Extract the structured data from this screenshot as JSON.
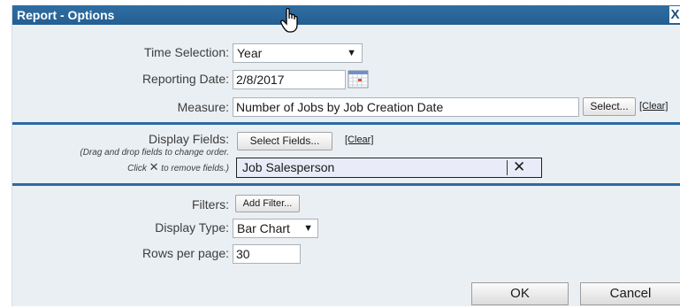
{
  "dialog": {
    "title": "Report - Options",
    "close_icon": "close-icon",
    "close_symbol": "X"
  },
  "time_selection": {
    "label": "Time Selection:",
    "value": "Year",
    "arrow": "▼"
  },
  "reporting_date": {
    "label": "Reporting Date:",
    "value": "2/8/2017",
    "icon": "calendar-icon"
  },
  "measure": {
    "label": "Measure:",
    "value": "Number of Jobs by Job Creation Date",
    "select_button": "Select...",
    "clear_link": "[Clear]"
  },
  "display_fields": {
    "label": "Display Fields:",
    "hint_line1": "(Drag and drop fields to change order.",
    "hint_line2_pre": "Click",
    "hint_line2_post": "to remove fields.)",
    "select_button": "Select Fields...",
    "clear_link": "[Clear]",
    "items": [
      {
        "label": "Job Salesperson",
        "remove_symbol": "✕"
      }
    ]
  },
  "filters": {
    "label": "Filters:",
    "add_button": "Add Filter..."
  },
  "display_type": {
    "label": "Display Type:",
    "value": "Bar Chart",
    "arrow": "▼"
  },
  "rows_per_page": {
    "label": "Rows per page:",
    "value": "30"
  },
  "footer": {
    "ok_button": "OK",
    "cancel_button": "Cancel"
  },
  "colors": {
    "titlebar": "#245e93",
    "divider": "#2b6aa4",
    "dialog_bg": "#eaeff3",
    "tag_bg": "#e9ecf8"
  }
}
